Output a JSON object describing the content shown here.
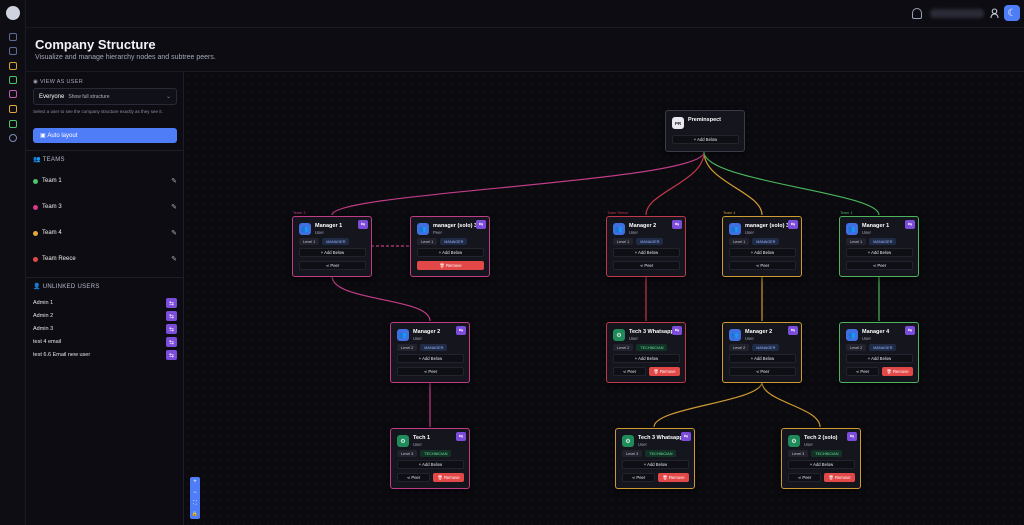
{
  "header": {
    "title": "Company Structure",
    "subtitle": "Visualize and manage hierarchy nodes and subtree peers."
  },
  "topbar": {
    "icons": [
      "bell-icon",
      "user-icon",
      "moon-icon"
    ]
  },
  "sidebar": {
    "view_as_label": "VIEW AS USER",
    "select_value": "Everyone",
    "select_hint": "Show full structure",
    "help_text": "Select a user to see the company structure exactly as they see it.",
    "auto_layout_label": "Auto layout",
    "teams_heading": "TEAMS",
    "teams": [
      {
        "label": "Team 1",
        "color": "#4ec46b"
      },
      {
        "label": "Team 3",
        "color": "#d63a8a"
      },
      {
        "label": "Team 4",
        "color": "#e0a93a"
      },
      {
        "label": "Team Reece",
        "color": "#e24848"
      }
    ],
    "unlinked_heading": "UNLINKED USERS",
    "unlinked": [
      "Admin 1",
      "Admin 2",
      "Admin 3",
      "test 4 email",
      "test 6.6 Email new user"
    ]
  },
  "actions": {
    "add_below": "+ Add Below",
    "peer": "Peer",
    "remove": "Remove"
  },
  "root": {
    "name": "Preminspect",
    "initials": "PR",
    "add_label": "+ Add Below"
  },
  "nodes": [
    {
      "name": "Manager 1",
      "role": "User",
      "level": "Level 1",
      "badge": "MANAGER",
      "team": "Team 3",
      "color": "#c03d86",
      "icon": "user",
      "remove": false
    },
    {
      "name": "manager (solo) 3",
      "role": "Peer",
      "level": "Level 1",
      "badge": "MANAGER",
      "team": "",
      "color": "#c03d86",
      "icon": "user",
      "remove": true,
      "remove_only": true
    },
    {
      "name": "Manager 2",
      "role": "User",
      "level": "Level 1",
      "badge": "MANAGER",
      "team": "Team Reece",
      "color": "#c0394a",
      "icon": "user",
      "remove": false
    },
    {
      "name": "manager (solo) 3",
      "role": "User",
      "level": "Level 1",
      "badge": "MANAGER",
      "team": "Team 4",
      "color": "#cf9a32",
      "icon": "user",
      "remove": false
    },
    {
      "name": "Manager 1",
      "role": "User",
      "level": "Level 1",
      "badge": "MANAGER",
      "team": "Team 1",
      "color": "#4cb45c",
      "icon": "user",
      "remove": false
    },
    {
      "name": "Manager 2",
      "role": "User",
      "level": "Level 2",
      "badge": "MANAGER",
      "team": "",
      "color": "#c03d86",
      "icon": "user",
      "remove": false
    },
    {
      "name": "Tech 3 Whatsapp",
      "role": "User",
      "level": "Level 2",
      "badge": "TECHNICIAN",
      "team": "",
      "color": "#c0394a",
      "icon": "tech",
      "remove": true
    },
    {
      "name": "Manager 2",
      "role": "User",
      "level": "Level 2",
      "badge": "MANAGER",
      "team": "",
      "color": "#cf9a32",
      "icon": "user",
      "remove": false
    },
    {
      "name": "Manager 4",
      "role": "User",
      "level": "Level 2",
      "badge": "MANAGER",
      "team": "",
      "color": "#4cb45c",
      "icon": "user",
      "remove": true
    },
    {
      "name": "Tech 1",
      "role": "User",
      "level": "Level 3",
      "badge": "TECHNICIAN",
      "team": "",
      "color": "#c03d86",
      "icon": "tech",
      "remove": true
    },
    {
      "name": "Tech 3 Whatsapp",
      "role": "User",
      "level": "Level 3",
      "badge": "TECHNICIAN",
      "team": "",
      "color": "#cf9a32",
      "icon": "tech",
      "remove": true
    },
    {
      "name": "Tech 2 (solo)",
      "role": "User",
      "level": "Level 3",
      "badge": "TECHNICIAN",
      "team": "",
      "color": "#cf9a32",
      "icon": "tech",
      "remove": true
    }
  ],
  "zoom_controls": [
    "+",
    "−",
    "⛶",
    "🔒"
  ]
}
